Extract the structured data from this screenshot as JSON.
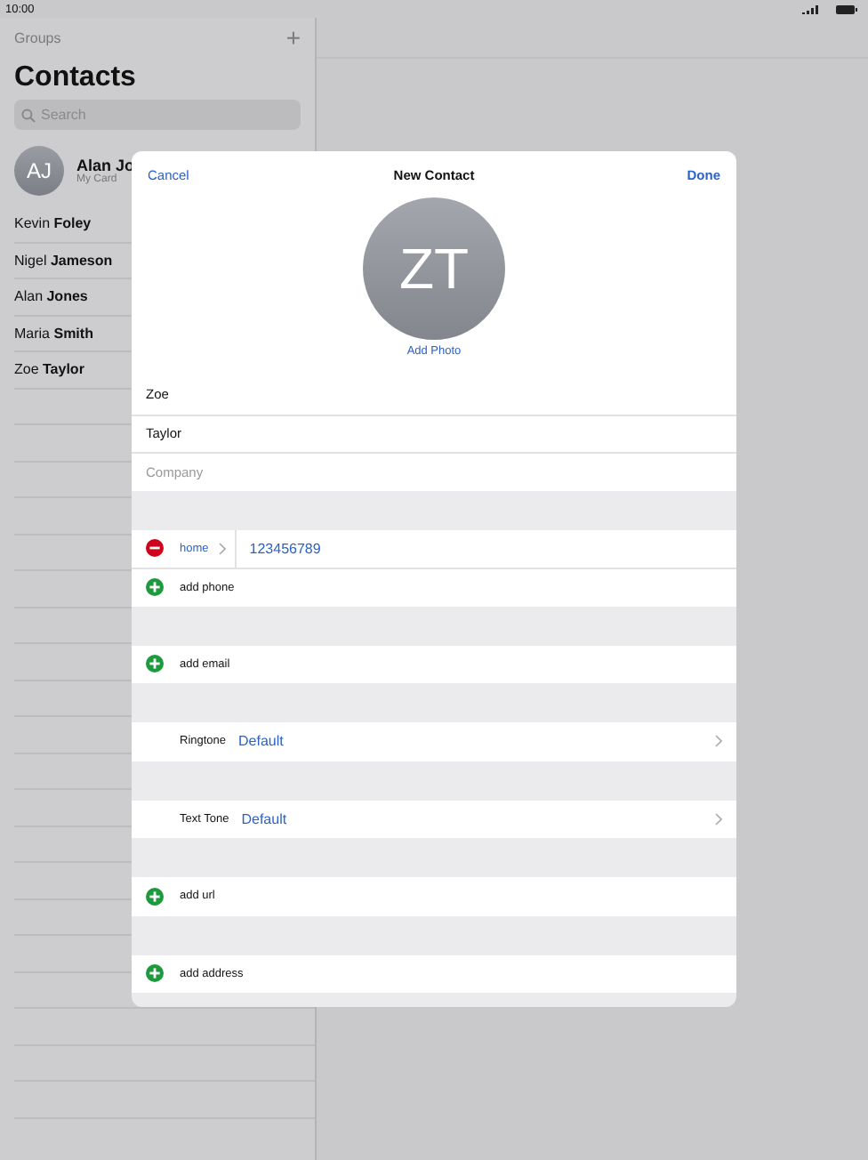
{
  "status_bar": {
    "time": "10:00"
  },
  "sidebar": {
    "groups_label": "Groups",
    "add_label": "+",
    "title": "Contacts",
    "search": {
      "placeholder": "Search"
    },
    "my_card": {
      "initials": "AJ",
      "name": "Alan Jo",
      "subtitle": "My Card"
    },
    "contacts": [
      "Kevin **Foley**",
      "Nigel **Jameson**",
      "Alan **Jones**",
      "Maria **Smith**",
      "Zoe **Taylor**"
    ]
  },
  "modal": {
    "cancel": "Cancel",
    "title": "New Contact",
    "done": "Done",
    "avatar_initials": "ZT",
    "add_photo": "Add Photo",
    "sections": [
      [
        {
          "kind": "field",
          "value": "Zoe"
        },
        {
          "kind": "field",
          "value": "Taylor"
        },
        {
          "kind": "field",
          "placeholder": "Company"
        }
      ],
      [
        {
          "kind": "phone",
          "label": "home",
          "value": "123456789"
        },
        {
          "kind": "add",
          "label": "add phone"
        }
      ],
      [
        {
          "kind": "add",
          "label": "add email"
        }
      ],
      [
        {
          "kind": "setting",
          "label": "Ringtone",
          "value": "Default"
        }
      ],
      [
        {
          "kind": "setting",
          "label": "Text Tone",
          "value": "Default"
        }
      ],
      [
        {
          "kind": "add",
          "label": "add url"
        }
      ],
      [
        {
          "kind": "add",
          "label": "add address"
        }
      ]
    ]
  }
}
